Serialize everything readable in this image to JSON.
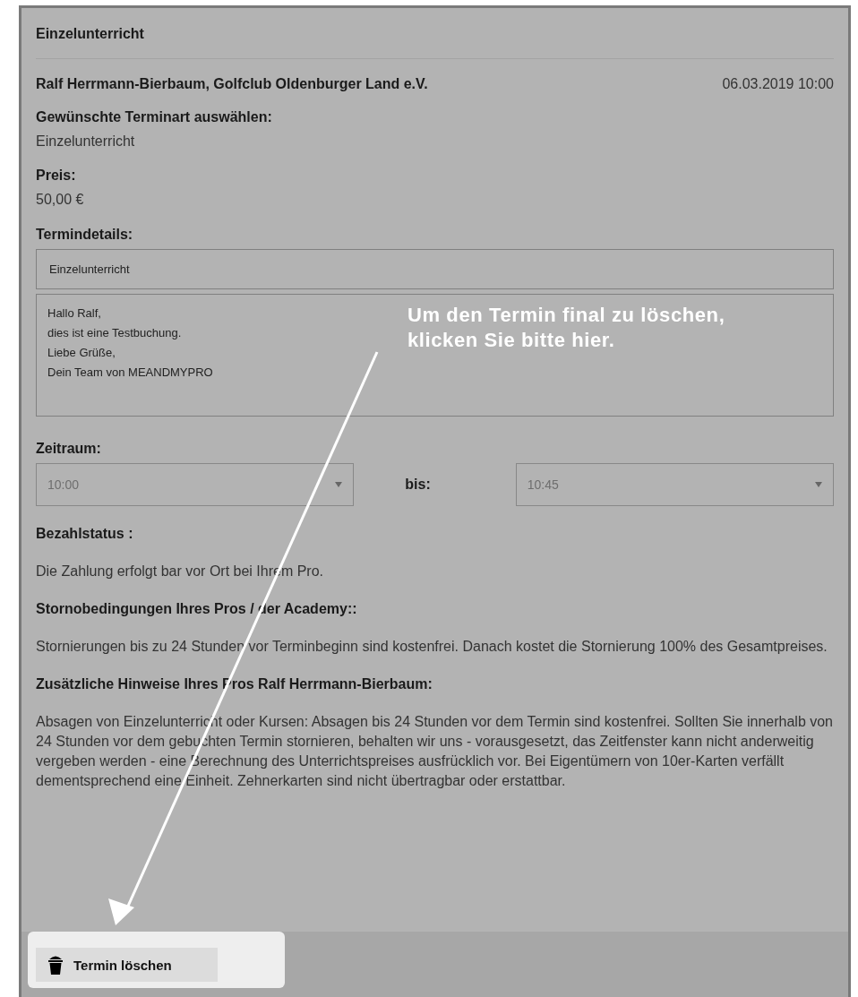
{
  "title": "Einzelunterricht",
  "booking": {
    "pro": "Ralf Herrmann-Bierbaum, Golfclub Oldenburger Land e.V.",
    "datetime": "06.03.2019 10:00"
  },
  "fields": [
    {
      "label": "Gewünschte Terminart auswählen:",
      "value": "Einzelunterricht"
    },
    {
      "label": "Preis:",
      "value": "50,00 €"
    }
  ],
  "details": {
    "label": "Termindetails:",
    "subject": "Einzelunterricht",
    "message": [
      "Hallo Ralf,",
      "dies ist eine Testbuchung.",
      "Liebe Grüße,",
      "Dein Team von MEANDMYPRO"
    ]
  },
  "period": {
    "label": "Zeitraum:",
    "from": "10:00",
    "to_label": "bis:",
    "to": "10:45"
  },
  "sections": [
    {
      "heading": "Bezahlstatus :",
      "text": "Die Zahlung erfolgt bar vor Ort bei Ihrem Pro."
    },
    {
      "heading": "Stornobedingungen Ihres Pros / der Academy::",
      "text": "Stornierungen bis zu 24 Stunden vor Terminbeginn sind kostenfrei. Danach kostet die Stornierung 100% des Gesamtpreises."
    },
    {
      "heading": "Zusätzliche Hinweise Ihres Pros Ralf Herrmann-Bierbaum:",
      "text": "Absagen von Einzelunterricht oder Kursen: Absagen bis 24 Stunden vor dem Termin sind kostenfrei. Sollten Sie innerhalb von 24 Stunden vor dem gebuchten Termin stornieren, behalten wir uns - vorausgesetzt, das Zeitfenster kann nicht anderweitig vergeben werden - eine Berechnung des Unterrichtspreises ausfrücklich vor. Bei Eigentümern von 10er-Karten verfällt dementsprechend eine Einheit. Zehnerkarten sind nicht übertragbar oder erstattbar."
    }
  ],
  "delete_button": {
    "label": "Termin löschen"
  },
  "annotation": {
    "text": "Um den Termin final zu löschen, klicken Sie bitte hier."
  }
}
